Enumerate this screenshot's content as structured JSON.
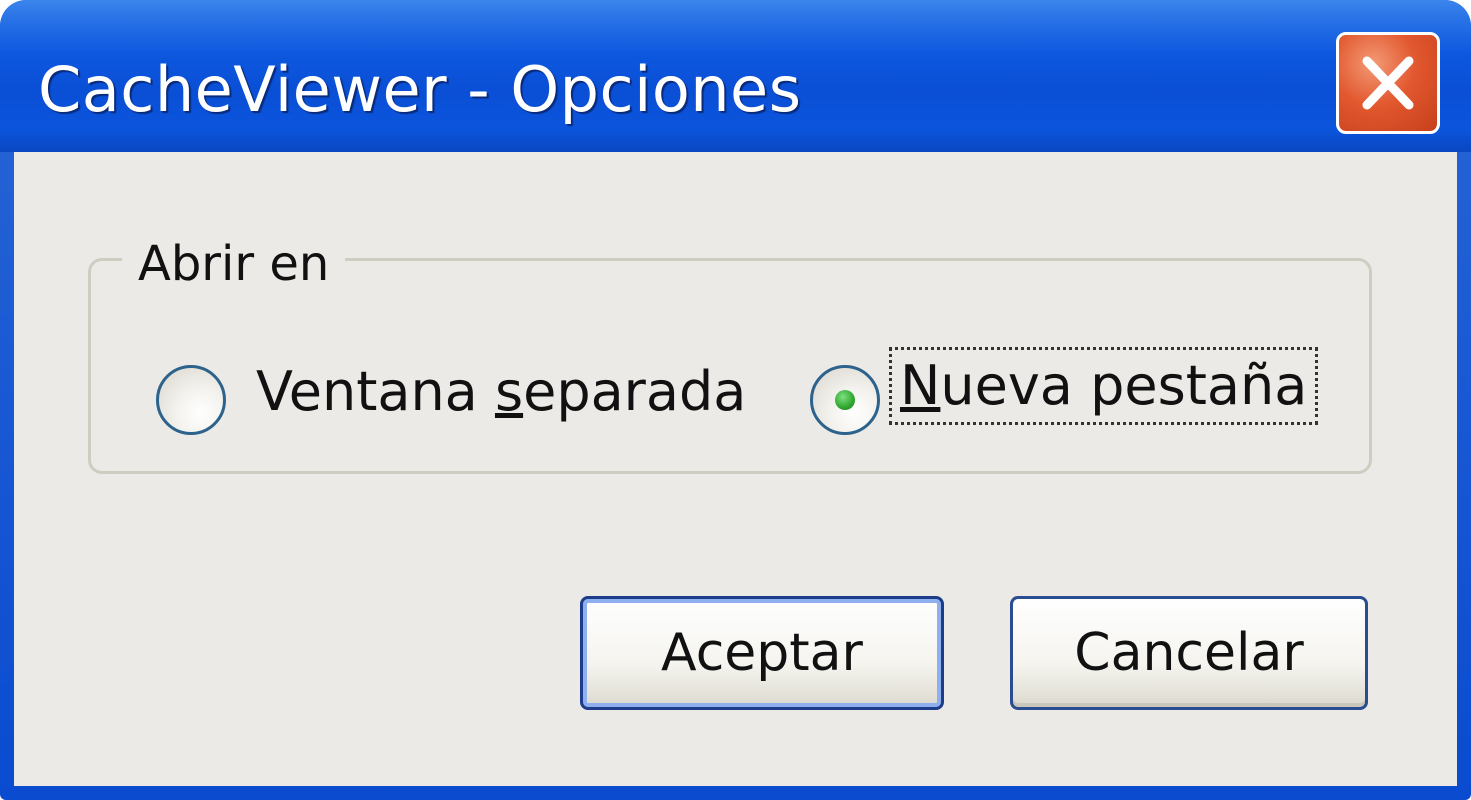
{
  "window": {
    "title": "CacheViewer - Opciones",
    "close_icon": "close-icon"
  },
  "group": {
    "legend": "Abrir en"
  },
  "options": {
    "separate_window": {
      "label": "Ventana separada",
      "accesskey": "s",
      "selected": false
    },
    "new_tab": {
      "label": "Nueva pestaña",
      "accesskey": "N",
      "selected": true,
      "focused": true
    }
  },
  "buttons": {
    "accept": "Aceptar",
    "cancel": "Cancelar"
  },
  "colors": {
    "titlebar": "#0a4fd6",
    "close_button": "#e2582f",
    "dialog_background": "#eceae6",
    "radio_dot": "#2fa62f",
    "button_border": "#1d3d8a"
  }
}
